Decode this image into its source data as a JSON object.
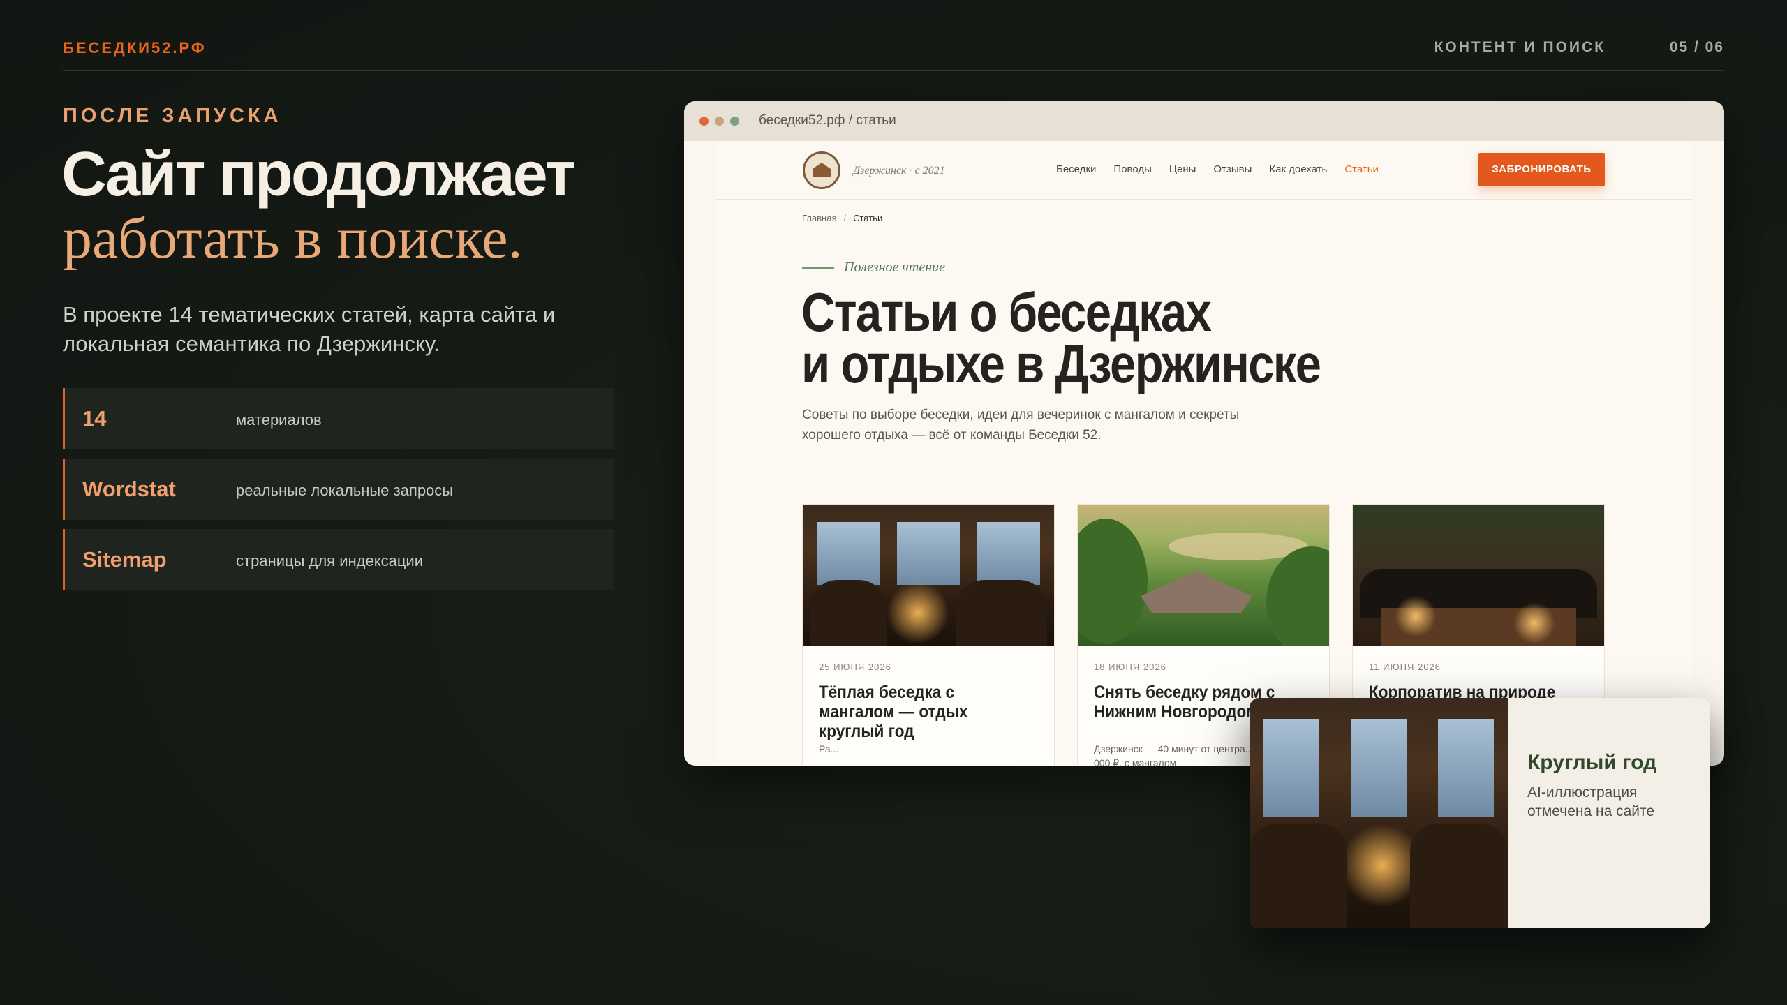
{
  "header": {
    "brand": "БЕСЕДКИ52.РФ",
    "section": "КОНТЕНТ И ПОИСК",
    "pager": "05 / 06"
  },
  "hero": {
    "eyebrow": "ПОСЛЕ ЗАПУСКА",
    "title_line1": "Сайт продолжает",
    "title_line2": "работать в поиске.",
    "lead": "В проекте 14 тематических статей, карта сайта и локальная семантика по Дзержинску."
  },
  "stats": [
    {
      "key": "14",
      "value": "материалов"
    },
    {
      "key": "Wordstat",
      "value": "реальные локальные запросы"
    },
    {
      "key": "Sitemap",
      "value": "страницы для индексации"
    }
  ],
  "browser": {
    "url": "беседки52.рф / статьи",
    "site": {
      "tagline": "Дзержинск · с 2021",
      "nav": [
        "Беседки",
        "Поводы",
        "Цены",
        "Отзывы",
        "Как доехать",
        "Статьи"
      ],
      "cta": "ЗАБРОНИРОВАТЬ",
      "breadcrumbs": {
        "home": "Главная",
        "sep": "/",
        "current": "Статьи"
      },
      "kicker": "Полезное чтение",
      "h1_line1": "Статьи о беседках",
      "h1_line2": "и отдыхе в Дзержинске",
      "subtitle": "Советы по выборе беседки, идеи для вечеринок с мангалом и секреты хорошего отдыха — всё от команды Беседки 52.",
      "articles": [
        {
          "date": "25 ИЮНЯ 2026",
          "title": "Тёплая беседка с мангалом — отдых круглый год",
          "excerpt": "Ра..."
        },
        {
          "date": "18 ИЮНЯ 2026",
          "title": "Снять беседку рядом с Нижним Новгородом",
          "excerpt": "Дзержинск — 40 минут от центра... беседок от 6 000 ₽, с мангалом"
        },
        {
          "date": "11 ИЮНЯ 2026",
          "title": "Корпоратив на природе в",
          "excerpt": ""
        }
      ]
    }
  },
  "callout": {
    "title": "Круглый год",
    "text": "AI-иллюстрация отмечена на сайте"
  },
  "colors": {
    "accent": "#e8651f",
    "background": "#151a15",
    "green": "#2f4a2c"
  }
}
